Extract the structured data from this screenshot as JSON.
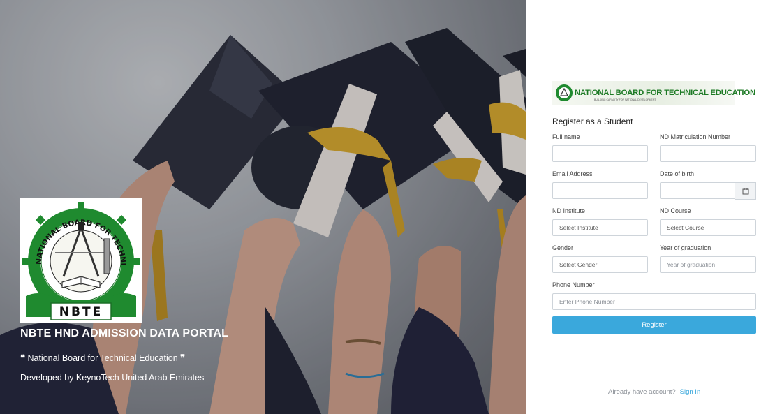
{
  "hero": {
    "title": "NBTE HND ADMISSION DATA PORTAL",
    "quote": "National Board for Technical Education",
    "developer": "Developed by KeynoTech United Arab Emirates",
    "logo_text": "NBTE",
    "logo_ring_text": "NATIONAL BOARD FOR TECHNICAL EDUCATION"
  },
  "banner": {
    "text": "NATIONAL BOARD FOR TECHNICAL EDUCATION",
    "sub": "BUILDING CAPACITY FOR NATIONAL DEVELOPMENT"
  },
  "form": {
    "title": "Register as a Student",
    "full_name_label": "Full name",
    "matric_label": "ND Matriculation Number",
    "email_label": "Email Address",
    "dob_label": "Date of birth",
    "institute_label": "ND Institute",
    "institute_value": "Select Institute",
    "course_label": "ND Course",
    "course_value": "Select Course",
    "gender_label": "Gender",
    "gender_value": "Select Gender",
    "year_label": "Year of graduation",
    "year_placeholder": "Year of graduation",
    "phone_label": "Phone Number",
    "phone_placeholder": "Enter Phone Number",
    "register_label": "Register"
  },
  "footer": {
    "question": "Already have account?",
    "signin": "Sign In"
  },
  "colors": {
    "accent": "#3aa8dc",
    "brand_green": "#1d7a25"
  }
}
